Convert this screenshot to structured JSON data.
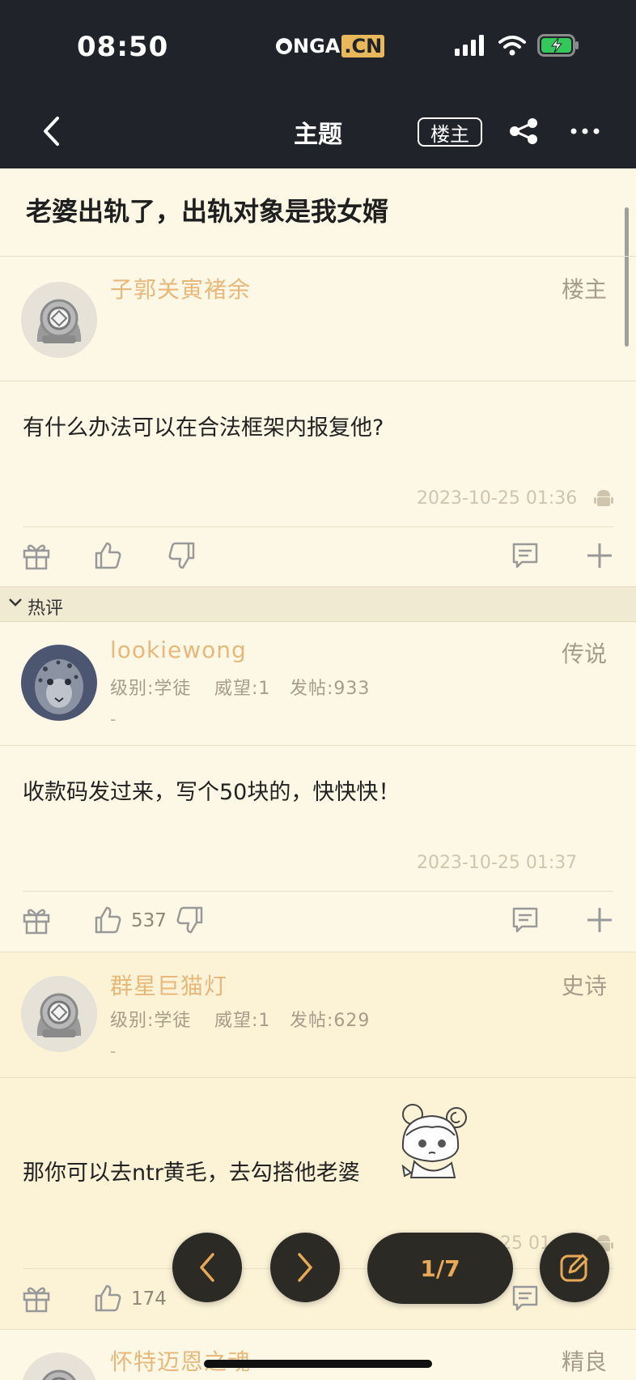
{
  "status_bar": {
    "time": "08:50",
    "carrier_prefix": "NGA",
    "carrier_suffix": ".CN"
  },
  "nav": {
    "title": "主题",
    "op_only_label": "楼主"
  },
  "topic": {
    "title": "老婆出轨了，出轨对象是我女婿"
  },
  "posts": [
    {
      "username": "子郭关寅褚余",
      "badge": "楼主",
      "content": "有什么办法可以在合法框架内报复他?",
      "timestamp": "2023-10-25 01:36"
    }
  ],
  "hot_section": {
    "label": "热评"
  },
  "replies": [
    {
      "username": "lookiewong",
      "badge": "传说",
      "level": "级别:学徒",
      "prestige": "威望:1",
      "posts_count": "发帖:933",
      "signature": "-",
      "content": "收款码发过来，写个50块的，快快快！",
      "timestamp": "2023-10-25 01:37",
      "likes": "537"
    },
    {
      "username": "群星巨猫灯",
      "badge": "史诗",
      "level": "级别:学徒",
      "prestige": "威望:1",
      "posts_count": "发帖:629",
      "signature": "-",
      "content": "那你可以去ntr黄毛，去勾搭他老婆",
      "timestamp_partial": "25 01:",
      "likes": "174"
    },
    {
      "username": "怀特迈恩之魂",
      "badge": "精良"
    }
  ],
  "pager": {
    "label": "1/7"
  },
  "colors": {
    "accent": "#e8b87b",
    "dark": "#21232a",
    "page_bg": "#fdf8e6",
    "pager_text": "#e8a956"
  }
}
